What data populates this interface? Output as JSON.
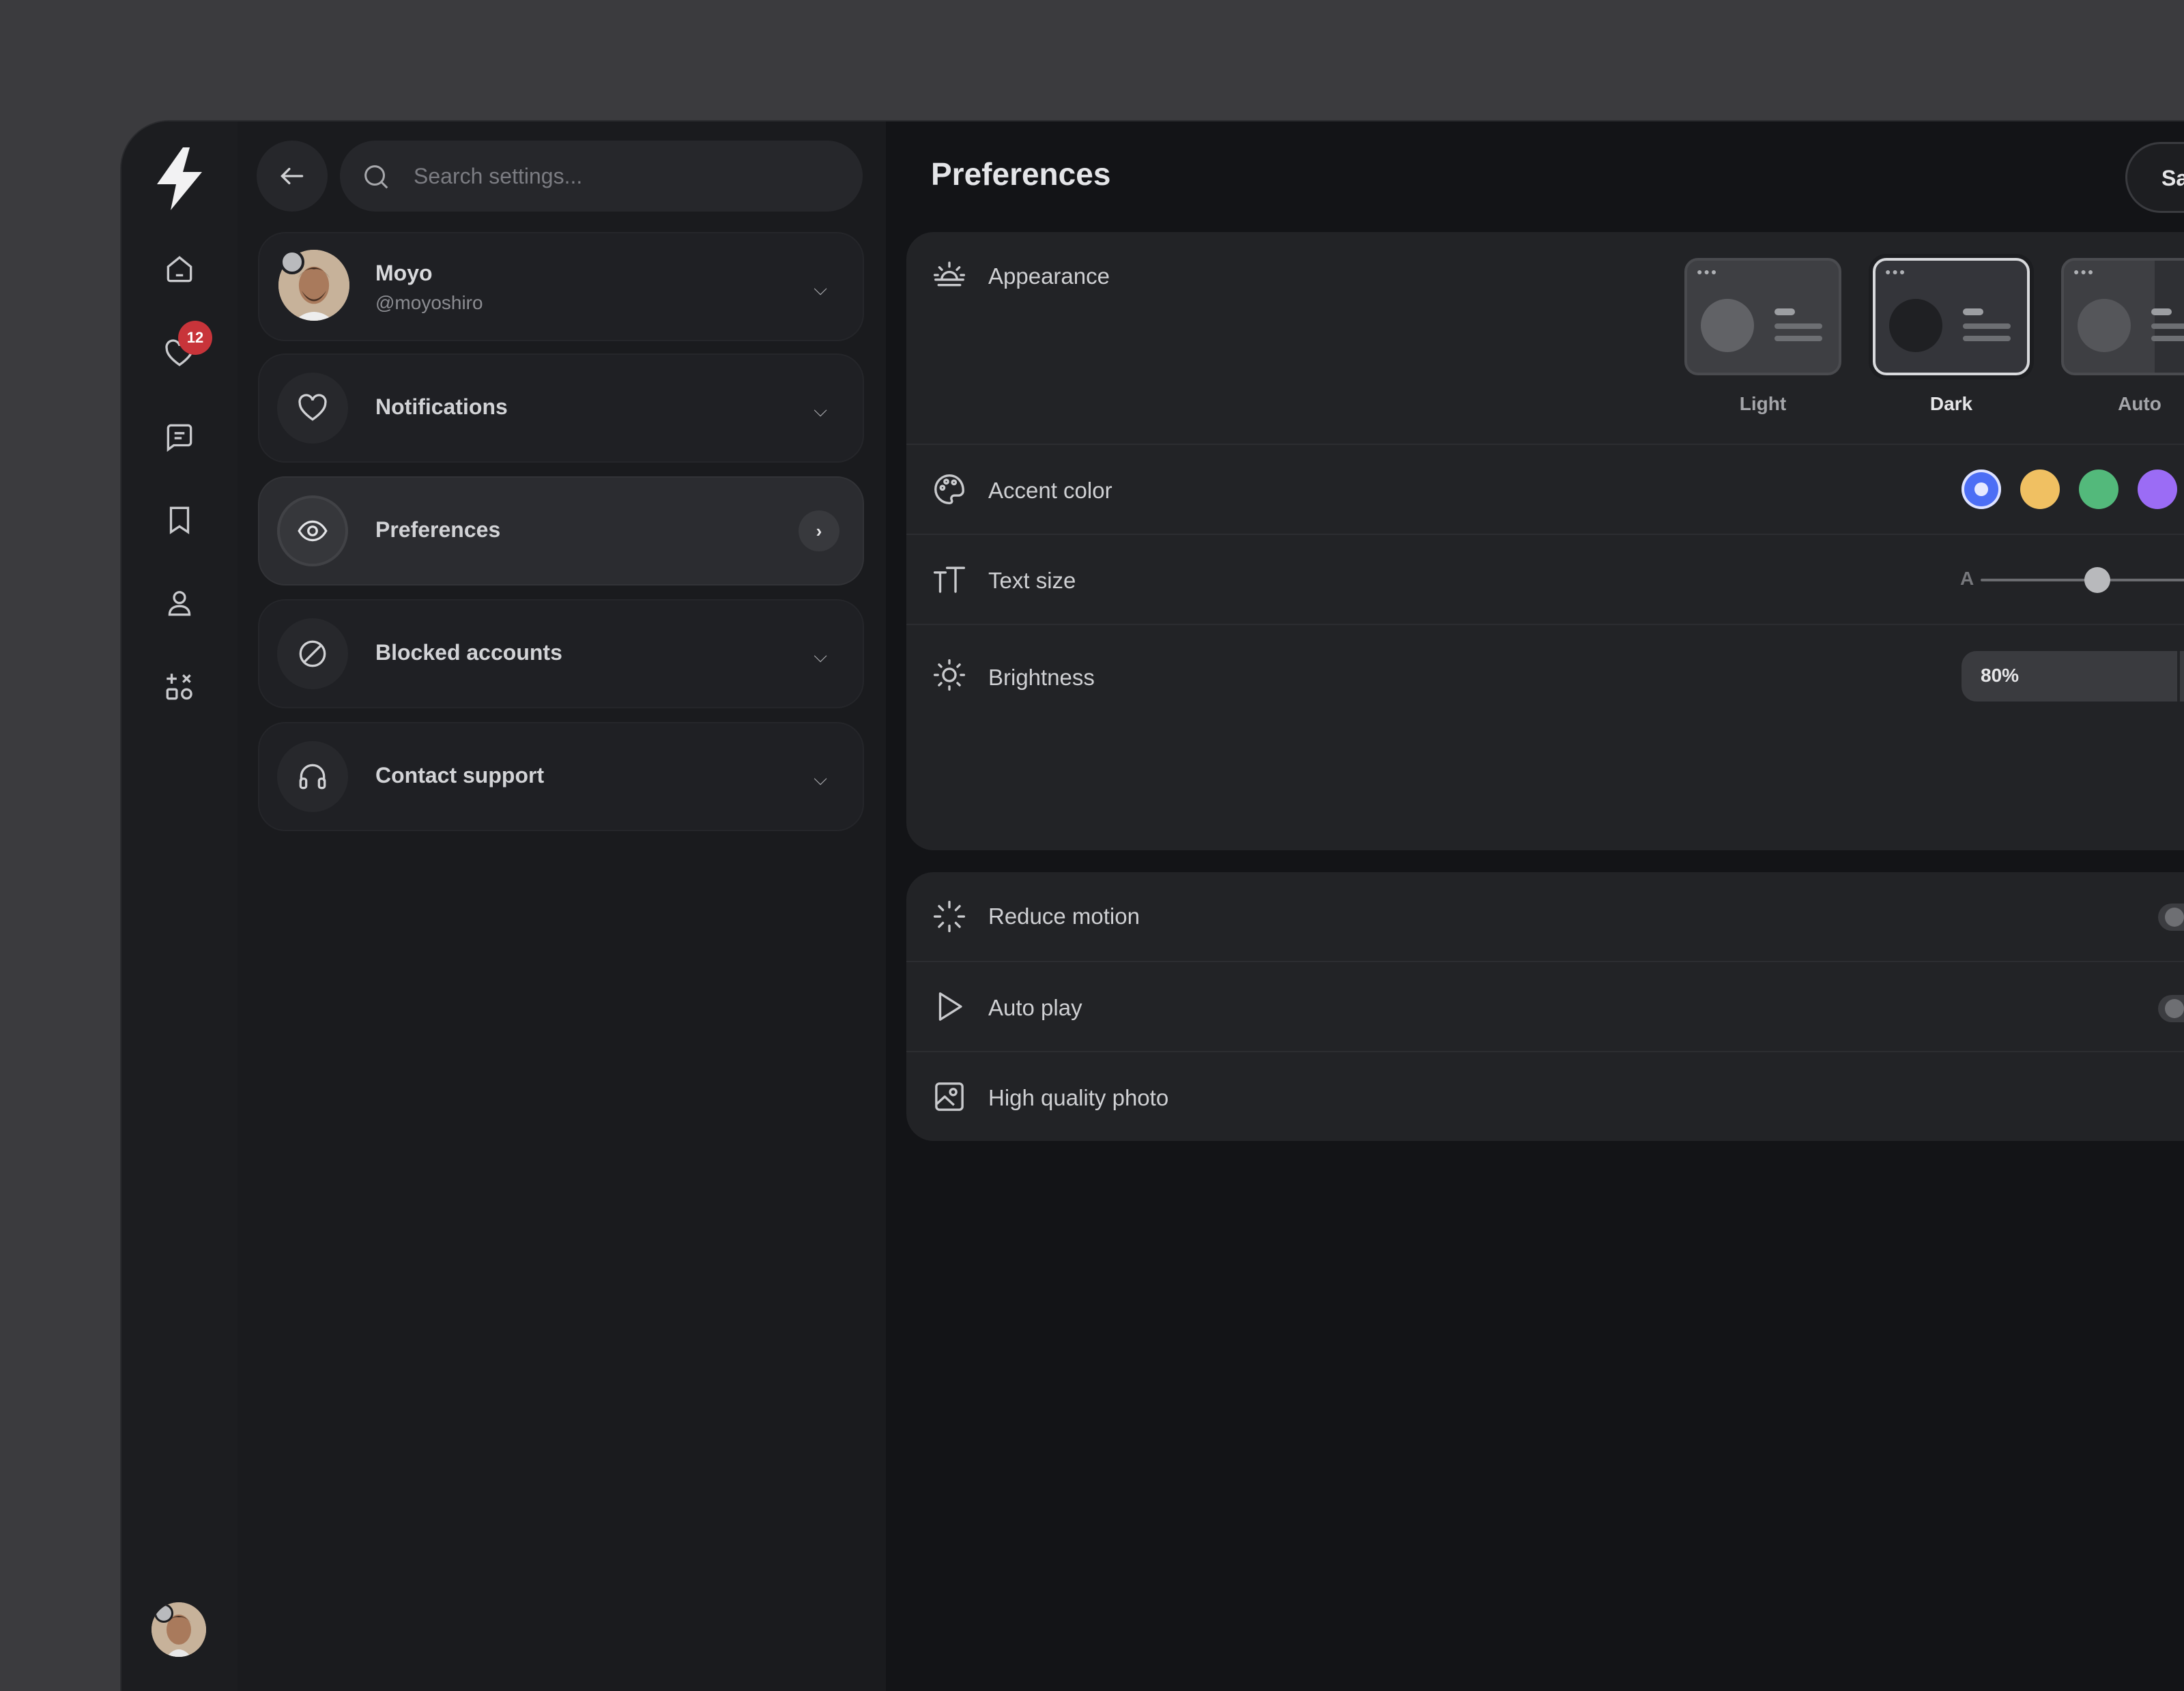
{
  "rail": {
    "badge_count": "12",
    "nav": [
      "home-icon",
      "heart-icon",
      "message-icon",
      "bookmark-icon",
      "user-icon",
      "apps-icon"
    ]
  },
  "search": {
    "placeholder": "Search settings..."
  },
  "profile": {
    "name": "Moyo",
    "handle": "@moyoshiro"
  },
  "menu": [
    {
      "label": "Notifications",
      "icon": "heart-icon"
    },
    {
      "label": "Preferences",
      "icon": "eye-icon",
      "active": true
    },
    {
      "label": "Blocked accounts",
      "icon": "block-icon"
    },
    {
      "label": "Contact support",
      "icon": "headset-icon"
    }
  ],
  "main": {
    "title": "Preferences",
    "save_label": "Sa",
    "appearance": {
      "label": "Appearance",
      "themes": [
        {
          "name": "Light"
        },
        {
          "name": "Dark",
          "selected": true
        },
        {
          "name": "Auto"
        }
      ]
    },
    "accent": {
      "label": "Accent color",
      "colors": [
        "#4c6ef5",
        "#f0c062",
        "#53b97b",
        "#9b6cf5"
      ],
      "selected": 0
    },
    "text_size": {
      "label": "Text size",
      "min_label": "A"
    },
    "brightness": {
      "label": "Brightness",
      "value": "80%"
    },
    "reduce_motion": {
      "label": "Reduce motion"
    },
    "auto_play": {
      "label": "Auto play"
    },
    "hq_photo": {
      "label": "High quality photo"
    }
  }
}
